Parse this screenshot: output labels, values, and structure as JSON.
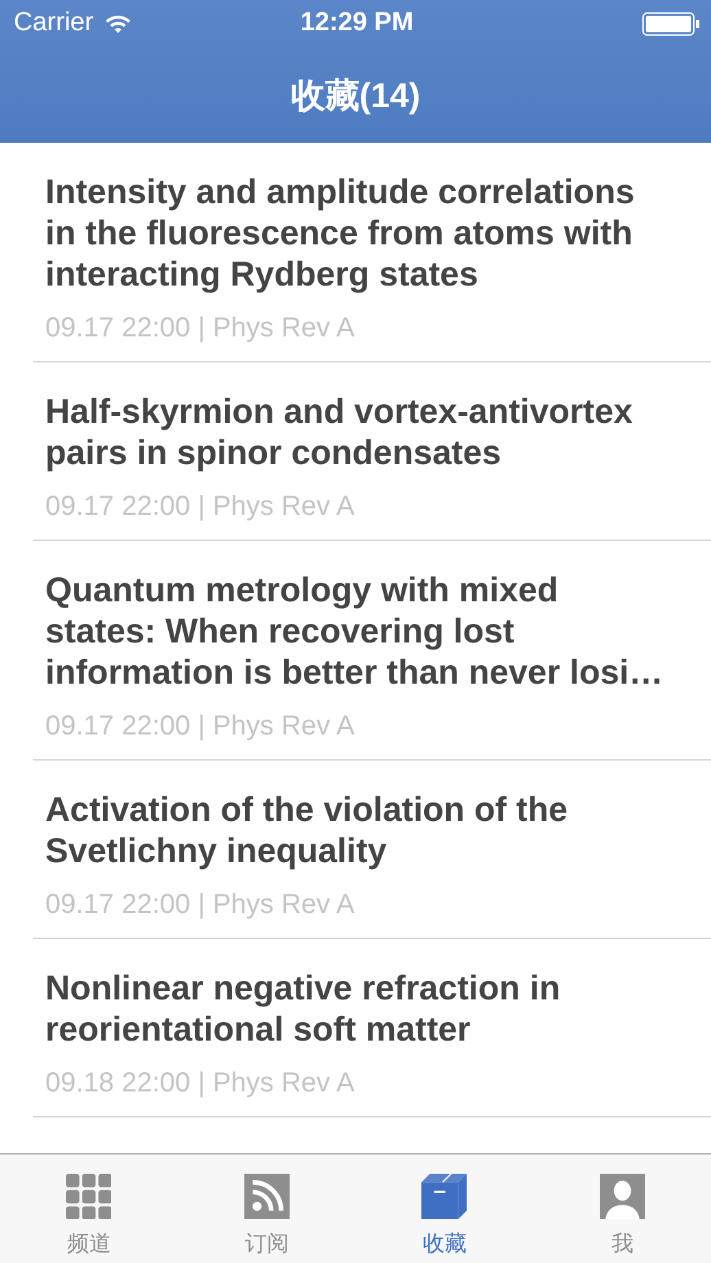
{
  "status_bar": {
    "carrier": "Carrier",
    "time": "12:29 PM"
  },
  "nav_bar": {
    "title": "收藏(14)"
  },
  "articles": [
    {
      "title": "Intensity and amplitude correlations in the fluorescence from atoms with interacting Rydberg states",
      "meta": "09.17 22:00 | Phys Rev A"
    },
    {
      "title": "Half-skyrmion and vortex-antivortex pairs in spinor condensates",
      "meta": "09.17 22:00 | Phys Rev A"
    },
    {
      "title": "Quantum metrology with mixed states: When recovering lost information is better than never losi…",
      "meta": "09.17 22:00 | Phys Rev A"
    },
    {
      "title": "Activation of the violation of the Svetlichny inequality",
      "meta": "09.17 22:00 | Phys Rev A"
    },
    {
      "title": "Nonlinear negative refraction in reorientational soft matter",
      "meta": "09.18 22:00 | Phys Rev A"
    }
  ],
  "tab_bar": [
    {
      "kind": "grid",
      "label": "频道",
      "selected": false
    },
    {
      "kind": "rss",
      "label": "订阅",
      "selected": false
    },
    {
      "kind": "box",
      "label": "收藏",
      "selected": true
    },
    {
      "kind": "person",
      "label": "我",
      "selected": false
    }
  ]
}
